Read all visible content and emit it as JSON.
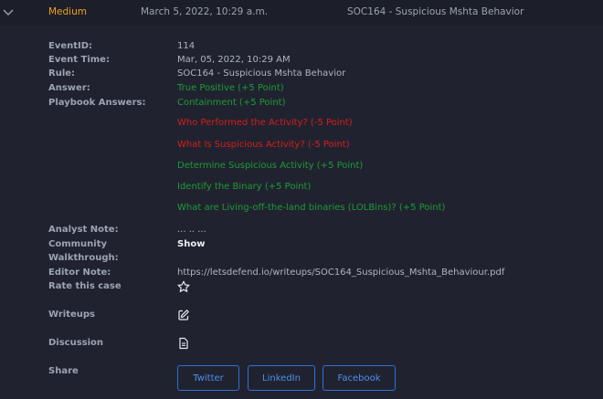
{
  "header": {
    "severity": "Medium",
    "date": "March 5, 2022, 10:29 a.m.",
    "rule": "SOC164 - Suspicious Mshta Behavior"
  },
  "details": {
    "event_id_label": "EventID:",
    "event_id": "114",
    "event_time_label": "Event Time:",
    "event_time": "Mar, 05, 2022, 10:29 AM",
    "rule_label": "Rule:",
    "rule": "SOC164 - Suspicious Mshta Behavior",
    "answer_label": "Answer:",
    "answer": "True Positive (+5 Point)",
    "playbook_label": "Playbook Answers:",
    "playbook_answers": [
      "Containment (+5 Point)",
      "Who Performed the Activity? (-5 Point)",
      "What Is Suspicious Activity? (-5 Point)",
      "Determine Suspicious Activity (+5 Point)",
      "Identify the Binary (+5 Point)",
      "What are Living-off-the-land binaries (LOLBins)? (+5 Point)"
    ],
    "analyst_note_label": "Analyst Note:",
    "analyst_note": "... .. ...",
    "community_label": "Community",
    "community_label2": "Walkthrough:",
    "community_value": "Show",
    "editor_note_label": "Editor Note:",
    "editor_note": "https://letsdefend.io/writeups/SOC164_Suspicious_Mshta_Behaviour.pdf",
    "rate_label": "Rate this case",
    "writeups_label": "Writeups",
    "discussion_label": "Discussion",
    "share_label": "Share"
  },
  "share": {
    "twitter": "Twitter",
    "linkedin": "LinkedIn",
    "facebook": "Facebook"
  },
  "colors": {
    "severity": "#f0a012",
    "positive": "#1d9a36",
    "negative": "#d71c1c",
    "accent": "#2e6fd8"
  },
  "icons": {
    "expand": "chevron-down-icon",
    "rate": "star-icon",
    "writeups": "edit-icon",
    "discussion": "document-icon"
  }
}
